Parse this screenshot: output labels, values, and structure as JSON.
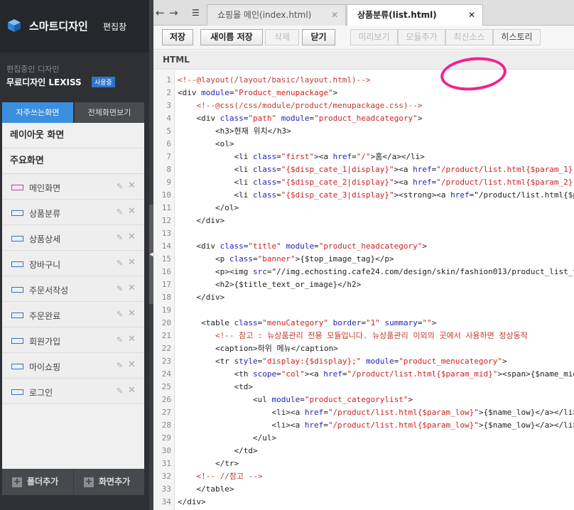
{
  "app": {
    "name": "스마트디자인",
    "subtitle": "편집창"
  },
  "current_design": {
    "label": "편집중인 디자인",
    "name": "무료디자인 LEXISS",
    "badge": "사용중"
  },
  "sidebar": {
    "tabs": [
      {
        "label": "자주쓰는화면",
        "active": true
      },
      {
        "label": "전체화면보기",
        "active": false
      }
    ],
    "sections": [
      "레이아웃 화면",
      "주요화면"
    ],
    "items": [
      {
        "label": "메인화면",
        "icon": "page-icon-pink"
      },
      {
        "label": "상품분류",
        "icon": "page-icon"
      },
      {
        "label": "상품상세",
        "icon": "page-icon"
      },
      {
        "label": "장바구니",
        "icon": "page-icon"
      },
      {
        "label": "주문서작성",
        "icon": "page-icon"
      },
      {
        "label": "주문완료",
        "icon": "page-icon"
      },
      {
        "label": "회원가입",
        "icon": "page-icon"
      },
      {
        "label": "마이쇼핑",
        "icon": "page-icon"
      },
      {
        "label": "로그인",
        "icon": "page-icon"
      }
    ],
    "add_folder": "폴더추가",
    "add_screen": "화면추가"
  },
  "file_tabs": [
    {
      "label": "쇼핑몰 메인(index.html)",
      "active": false
    },
    {
      "label": "상품분류(list.html)",
      "active": true
    }
  ],
  "toolbar": {
    "save": "저장",
    "save_as": "새이름 저장",
    "delete": "삭제",
    "close": "닫기",
    "preview": "미리보기",
    "add_module": "모듈추가",
    "restore": "최신소스",
    "history": "히스토리"
  },
  "mode": "HTML",
  "code_lines": [
    "<!--@layout(/layout/basic/layout.html)-->",
    "<div module=\"Product_menupackage\">",
    "    <!--@css(/css/module/product/menupackage.css)-->",
    "    <div class=\"path\" module=\"product_headcategory\">",
    "        <h3>현재 위치</h3>",
    "        <ol>",
    "            <li class=\"first\"><a href=\"/\">홈</a></li>",
    "            <li class=\"{$disp_cate_1|display}\"><a href=\"/product/list.html{$param_1}\">{",
    "            <li class=\"{$disp_cate_2|display}\"><a href=\"/product/list.html{$param_2}\">{",
    "            <li class=\"{$disp_cate_3|display}\"><strong><a href=\"/product/list.html{$par",
    "        </ol>",
    "    </div>",
    "",
    "    <div class=\"title\" module=\"product_headcategory\">",
    "        <p class=\"banner\">{$top_image_tag}</p>",
    "        <p><img src=\"//img.echosting.cafe24.com/design/skin/fashion013/product_list_tit",
    "        <h2>{$title_text_or_image}</h2>",
    "    </div>",
    "",
    "     <table class=\"menuCategory\" border=\"1\" summary=\"\">",
    "        <!-- 참고 : 뉴상품관리 전용 모듈입니다. 뉴상품관리 이외의 곳에서 사용하면 정상동작",
    "        <caption>하위 메뉴</caption>",
    "        <tr style=\"display:{$display};\" module=\"product_menucategory\">",
    "            <th scope=\"col\"><a href=\"/product/list.html{$param_mid}\"><span>{$name_mid}</",
    "            <td>",
    "                <ul module=\"product_categorylist\">",
    "                    <li><a href=\"/product/list.html{$param_low}\">{$name_low}</a></li>",
    "                    <li><a href=\"/product/list.html{$param_low}\">{$name_low}</a></li>",
    "                </ul>",
    "            </td>",
    "        </tr>",
    "    <!-- //참고 -->",
    "    </table>",
    "</div>"
  ],
  "colors": {
    "accent": "#3a8fde",
    "annotation": "#f0238f",
    "comment": "#c0392b",
    "attribute": "#2222bb",
    "string": "#cc2222"
  }
}
